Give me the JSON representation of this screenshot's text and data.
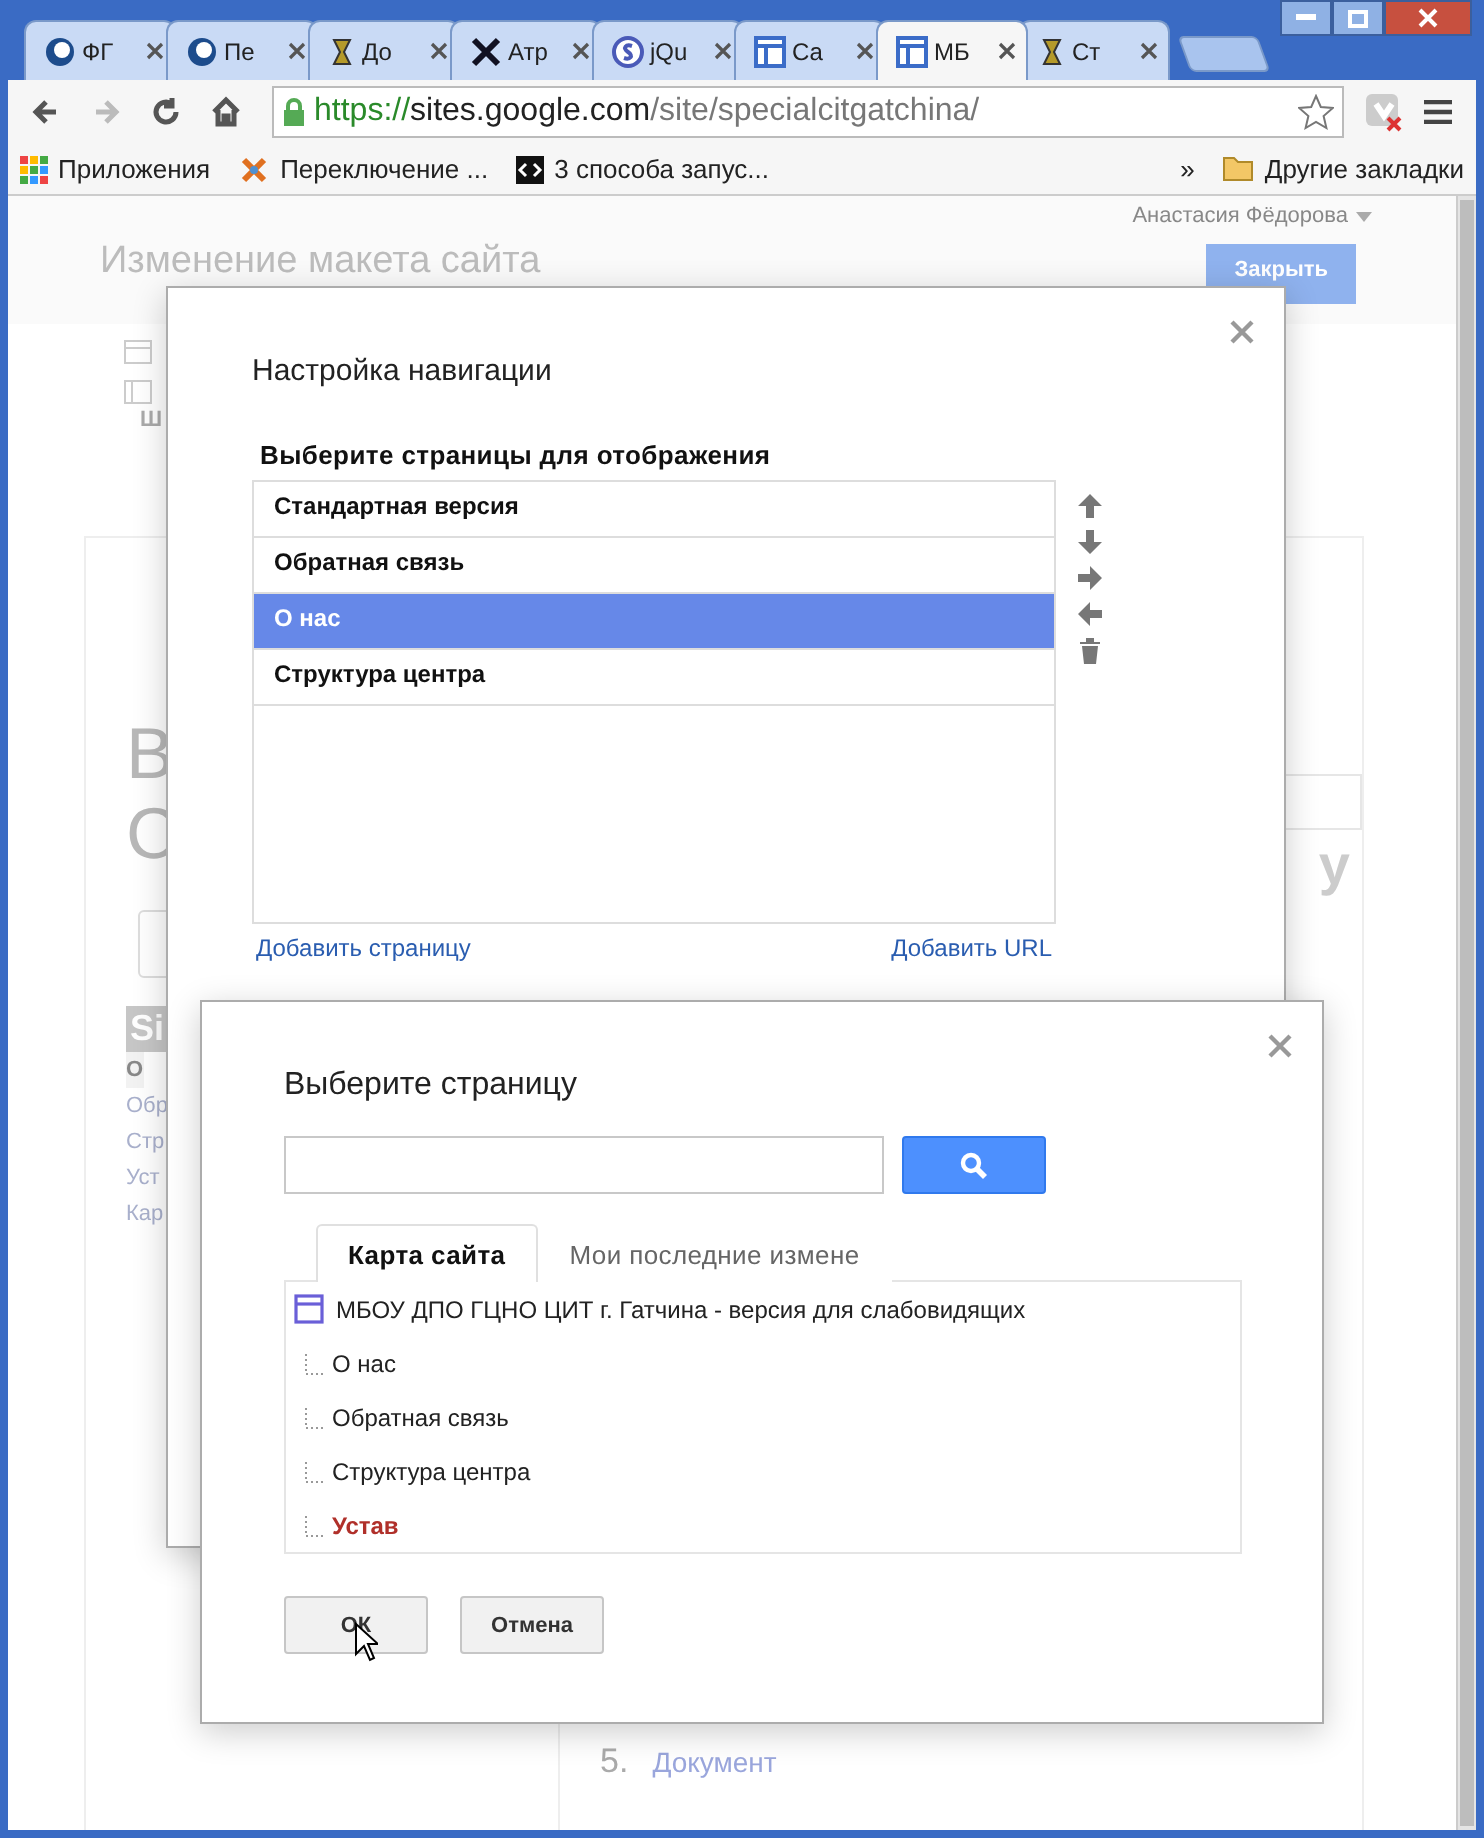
{
  "browser": {
    "tabs": [
      {
        "title": "ФГ",
        "kind": "globe",
        "selected": false
      },
      {
        "title": "Пе",
        "kind": "globe",
        "selected": false
      },
      {
        "title": "До",
        "kind": "scroll",
        "selected": false
      },
      {
        "title": "Атр",
        "kind": "cross",
        "selected": false
      },
      {
        "title": "jQu",
        "kind": "coin",
        "selected": false
      },
      {
        "title": "Са",
        "kind": "layout",
        "selected": false
      },
      {
        "title": "МБ",
        "kind": "layout",
        "selected": true
      },
      {
        "title": "Ст",
        "kind": "scroll",
        "selected": false
      }
    ],
    "toolbar": [
      {
        "kind": "back",
        "disabled": false
      },
      {
        "kind": "forward",
        "disabled": true
      },
      {
        "kind": "reload",
        "disabled": false
      },
      {
        "kind": "home",
        "disabled": false
      }
    ],
    "url": {
      "scheme": "https://",
      "host": "sites.google.com",
      "path": "/site/specialcitgatchina/"
    },
    "bookmarks": [
      {
        "label": "Приложения",
        "kind": "apps"
      },
      {
        "label": "Переключение ...",
        "kind": "joomla"
      },
      {
        "label": "3 способа запус...",
        "kind": "code"
      }
    ],
    "bookmarks_overflow": "»",
    "other_bookmarks": "Другие закладки"
  },
  "page": {
    "user": "Анастасия Фёдорова",
    "title": "Изменение макета сайта",
    "close_button": "Закрыть",
    "side_label": "Ш",
    "big_letters": [
      "В",
      "С"
    ],
    "right_letter": "у",
    "sidebar_heading": "Si",
    "sidebar_items": [
      {
        "label": "О",
        "selected": true
      },
      {
        "label": "Обр",
        "selected": false
      },
      {
        "label": "Стр",
        "selected": false
      },
      {
        "label": "Уст",
        "selected": false
      },
      {
        "label": "Кар",
        "selected": false
      }
    ],
    "numbered_item": {
      "number": "5.",
      "label": "Документ"
    }
  },
  "navigation_dialog": {
    "title": "Настройка навигации",
    "list_label": "Выберите страницы для отображения",
    "pages": [
      {
        "label": "Стандартная версия",
        "selected": false
      },
      {
        "label": "Обратная связь",
        "selected": false
      },
      {
        "label": "О нас",
        "selected": true
      },
      {
        "label": "Структура центра",
        "selected": false
      }
    ],
    "actions": [
      {
        "kind": "up"
      },
      {
        "kind": "down"
      },
      {
        "kind": "right"
      },
      {
        "kind": "left"
      },
      {
        "kind": "delete"
      }
    ],
    "add_page": "Добавить страницу",
    "add_url": "Добавить URL"
  },
  "page_picker_dialog": {
    "title": "Выберите страницу",
    "tabs": [
      {
        "label": "Карта сайта",
        "selected": true
      },
      {
        "label": "Мои последние измене",
        "selected": false
      }
    ],
    "tree": {
      "label": "МБОУ ДПО ГЦНО ЦИТ г. Гатчина - версия для слабовидящих",
      "children": [
        {
          "label": "О нас",
          "selected": false
        },
        {
          "label": "Обратная связь",
          "selected": false
        },
        {
          "label": "Структура центра",
          "selected": false
        },
        {
          "label": "Устав",
          "selected": true
        }
      ]
    },
    "ok": "ОК",
    "cancel": "Отмена"
  }
}
